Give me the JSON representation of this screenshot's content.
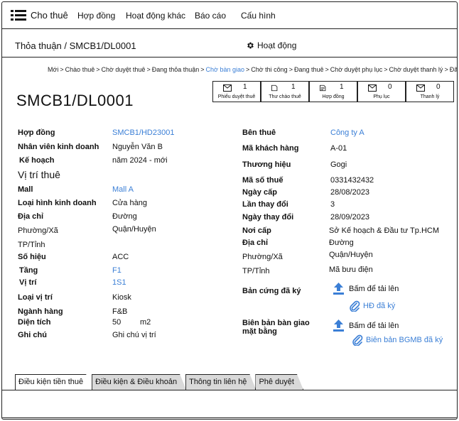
{
  "nav": {
    "brand": "Cho thuê",
    "items": [
      "Hợp đồng",
      "Hoạt động khác",
      "Báo cáo",
      "Cấu hình"
    ]
  },
  "subheader": {
    "breadcrumb": "Thỏa thuận / SMCB1/DL0001",
    "activity_label": "Hoạt động"
  },
  "steps": [
    {
      "label": "Mới",
      "active": false
    },
    {
      "label": "Chào thuê",
      "active": false
    },
    {
      "label": "Chờ duyệt thuê",
      "active": false
    },
    {
      "label": "Đang thỏa thuận",
      "active": false
    },
    {
      "label": "Chờ bàn giao",
      "active": true
    },
    {
      "label": "Chờ thi công",
      "active": false
    },
    {
      "label": "Đang thuê",
      "active": false
    },
    {
      "label": "Chờ duyệt phụ lục",
      "active": false
    },
    {
      "label": "Chờ duyệt thanh lý",
      "active": false
    },
    {
      "label": "Đã thanh lý",
      "active": false
    }
  ],
  "record": {
    "title": "SMCB1/DL0001"
  },
  "counters": [
    {
      "icon": "envelope-icon",
      "count": "1",
      "label": "Phiếu duyệt thuê"
    },
    {
      "icon": "document-icon",
      "count": "1",
      "label": "Thư chào thuê"
    },
    {
      "icon": "contract-icon",
      "count": "1",
      "label": "Hợp đồng"
    },
    {
      "icon": "envelope-icon",
      "count": "0",
      "label": "Phụ lục"
    },
    {
      "icon": "envelope-icon",
      "count": "0",
      "label": "Thanh lý"
    }
  ],
  "left": {
    "contract_label": "Hợp đồng",
    "contract_value": "SMCB1/HD23001",
    "staff_label": "Nhân viên kinh doanh",
    "staff_value": "Nguyễn Văn B",
    "plan_label": "Kế hoạch",
    "plan_value": "năm 2024 - mới",
    "section_title": "Vị trí thuê",
    "mall_label": "Mall",
    "mall_value": "Mall A",
    "biz_type_label": "Loại hình kinh doanh",
    "biz_type_value": "Cửa hàng",
    "address_label": "Địa chỉ",
    "address_value": "Đường",
    "ward_label": "Phường/Xã",
    "district_value": "Quận/Huyện",
    "city_label": "TP/Tỉnh",
    "code_label": "Số hiệu",
    "code_value": "ACC",
    "floor_label": "Tầng",
    "floor_value": "F1",
    "position_label": "Vị trí",
    "position_value": "1S1",
    "pos_type_label": "Loại vị trí",
    "pos_type_value": "Kiosk",
    "industry_label": "Ngành hàng",
    "industry_value": "F&B",
    "area_label": "Diện tích",
    "area_value": "50",
    "area_unit": "m2",
    "note_label": "Ghi chú",
    "note_value": "Ghi chú vị trí"
  },
  "right": {
    "tenant_label": "Bên thuê",
    "tenant_value": "Công ty A",
    "customer_code_label": "Mã khách hàng",
    "customer_code_value": "A-01",
    "brand_label": "Thương hiệu",
    "brand_value": "Gogi",
    "tax_label": "Mã số thuế",
    "tax_value": "0331432432",
    "issue_date_label": "Ngày cấp",
    "issue_date_value": "28/08/2023",
    "change_count_label": "Lần thay đổi",
    "change_count_value": "3",
    "change_date_label": "Ngày thay đổi",
    "change_date_value": "28/09/2023",
    "issued_by_label": "Nơi cấp",
    "issued_by_value": "Sở Kế hoạch & Đầu tư Tp.HCM",
    "address_label": "Địa chỉ",
    "address_value": "Đường",
    "ward_label": "Phường/Xã",
    "district_value": "Quận/Huyện",
    "city_label": "TP/Tỉnh",
    "postal_value": "Mã bưu điện",
    "signed_copy_label": "Bản cứng đã ký",
    "upload_label_1": "Bấm để tải lên",
    "file_1": "HĐ đã ký",
    "handover_label": "Biên bản bàn giao mặt bằng",
    "upload_label_2": "Bấm để tải lên",
    "file_2": "Biên bản BGMB đã ký"
  },
  "tabs": [
    {
      "label": "Điều kiện tiền thuê",
      "active": true
    },
    {
      "label": "Điều kiện & Điều khoản",
      "active": false
    },
    {
      "label": "Thông tin liên hệ",
      "active": false
    },
    {
      "label": "Phê duyệt",
      "active": false
    }
  ],
  "colors": {
    "link": "#3b7fd6",
    "border": "#222222",
    "inactive_tab": "#d9d9d9"
  }
}
